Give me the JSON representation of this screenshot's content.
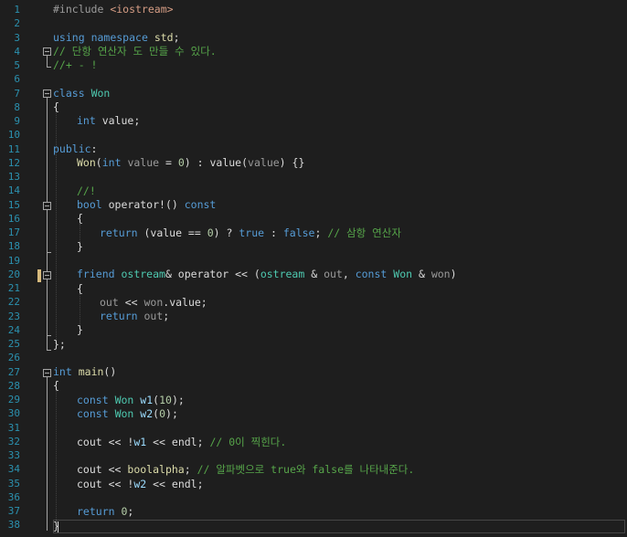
{
  "editor": {
    "line_numbers": [
      "1",
      "2",
      "3",
      "4",
      "5",
      "6",
      "7",
      "8",
      "9",
      "10",
      "11",
      "12",
      "13",
      "14",
      "15",
      "16",
      "17",
      "18",
      "19",
      "20",
      "21",
      "22",
      "23",
      "24",
      "25",
      "26",
      "27",
      "28",
      "29",
      "30",
      "31",
      "32",
      "33",
      "34",
      "35",
      "36",
      "37",
      "38"
    ],
    "lines": {
      "l1": [
        "#include ",
        "<iostream>"
      ],
      "l3": [
        "using",
        " ",
        "namespace",
        " ",
        "std",
        ";"
      ],
      "l4": [
        "// 단항 연산자 도 만들 수 있다."
      ],
      "l5": [
        "//+ - !"
      ],
      "l7": [
        "class",
        " ",
        "Won"
      ],
      "l8": [
        "{"
      ],
      "l9": [
        "int",
        " value;"
      ],
      "l11": [
        "public",
        ":"
      ],
      "l12": [
        "Won",
        "(",
        "int",
        " ",
        "value",
        " = ",
        "0",
        ") : ",
        "value",
        "(",
        "value",
        ") {}"
      ],
      "l14": [
        "//!"
      ],
      "l15": [
        "bool",
        " operator!() ",
        "const"
      ],
      "l16": [
        "{"
      ],
      "l17": [
        "return",
        " (value == ",
        "0",
        ") ? ",
        "true",
        " : ",
        "false",
        "; ",
        "// 삼항 연산자"
      ],
      "l18": [
        "}"
      ],
      "l20": [
        "friend",
        " ",
        "ostream",
        "& operator << (",
        "ostream",
        " & ",
        "out",
        ", ",
        "const",
        " ",
        "Won",
        " & ",
        "won",
        ")"
      ],
      "l21": [
        "{"
      ],
      "l22": [
        "out",
        " << ",
        "won",
        ".value;"
      ],
      "l23": [
        "return",
        " ",
        "out",
        ";"
      ],
      "l24": [
        "}"
      ],
      "l25": [
        "};"
      ],
      "l27": [
        "int",
        " ",
        "main",
        "()"
      ],
      "l28": [
        "{"
      ],
      "l29": [
        "const",
        " ",
        "Won",
        " ",
        "w1",
        "(",
        "10",
        ");"
      ],
      "l30": [
        "const",
        " ",
        "Won",
        " ",
        "w2",
        "(",
        "0",
        ");"
      ],
      "l32": [
        "cout",
        " << !",
        "w1",
        " << ",
        "endl",
        "; ",
        "// 0이 찍힌다."
      ],
      "l34": [
        "cout",
        " << ",
        "boolalpha",
        "; ",
        "// 알파벳으로 true와 false를 나타내준다."
      ],
      "l35": [
        "cout",
        " << !",
        "w2",
        " << ",
        "endl",
        ";"
      ],
      "l37": [
        "return",
        " ",
        "0",
        ";"
      ],
      "l38": [
        "}"
      ]
    }
  },
  "colors": {
    "background": "#1e1e1e",
    "line_number": "#2b91af",
    "keyword": "#569cd6",
    "type": "#4ec9b0",
    "function": "#dcdcaa",
    "variable": "#9cdcfe",
    "comment": "#57a64a",
    "number": "#b5cea8",
    "string": "#d69d85",
    "change_marker": "#d7ba7d"
  }
}
